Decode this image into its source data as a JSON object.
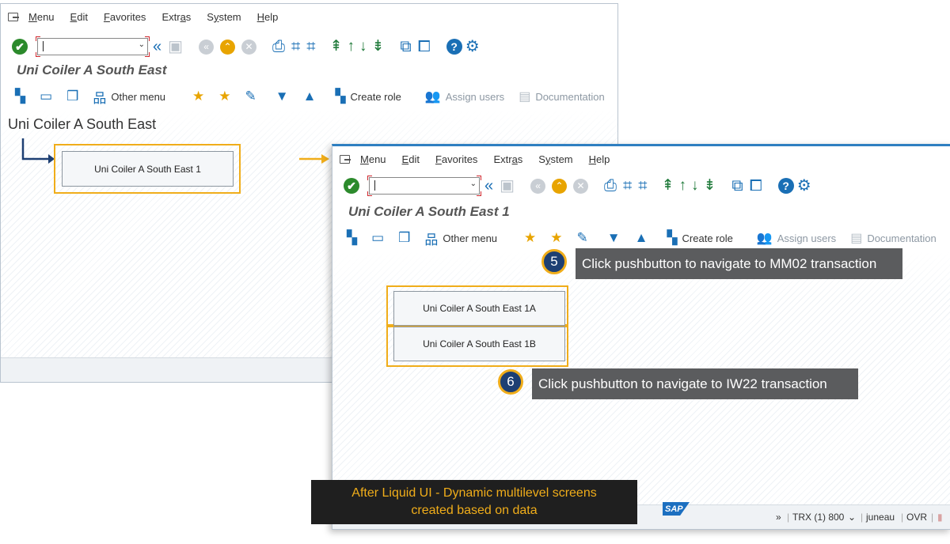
{
  "menu": [
    "Menu",
    "Edit",
    "Favorites",
    "Extras",
    "System",
    "Help"
  ],
  "menu_underline": [
    "M",
    "E",
    "F",
    "a",
    "y",
    "H"
  ],
  "window1": {
    "title": "Uni Coiler A South East",
    "heading": "Uni Coiler A South East",
    "button": "Uni Coiler A South East 1"
  },
  "window2": {
    "title": "Uni Coiler A South East 1",
    "button_a": "Uni Coiler A South East 1A",
    "button_b": "Uni Coiler A South East 1B"
  },
  "app_toolbar": {
    "other_menu": "Other menu",
    "create_role": "Create role",
    "assign_users": "Assign users",
    "documentation": "Documentation"
  },
  "status": {
    "chevron": "»",
    "trx": "TRX (1) 800",
    "user": "juneau",
    "mode": "OVR",
    "sap": "SAP"
  },
  "callouts": [
    {
      "num": "5",
      "text": "Click pushbutton to navigate to MM02 transaction"
    },
    {
      "num": "6",
      "text": "Click pushbutton to navigate to IW22 transaction"
    }
  ],
  "banner": {
    "line1": "After Liquid UI - Dynamic multilevel screens",
    "line2": "created based on data"
  },
  "colors": {
    "highlight": "#f0ad1a",
    "sap_blue": "#1a6fb5",
    "callout_bg": "#5b5c5e",
    "banner_bg": "#1f1f1f"
  }
}
